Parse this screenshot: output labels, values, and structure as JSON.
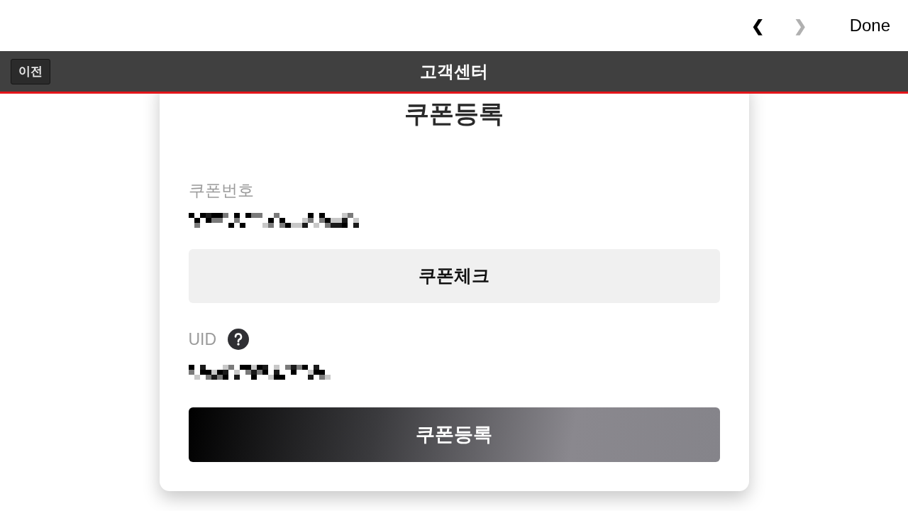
{
  "browser_bar": {
    "nav_buttons": [
      {
        "label": "❮",
        "disabled": false
      },
      {
        "label": "❯",
        "disabled": true
      }
    ],
    "done_button": "Done"
  },
  "header": {
    "back_button": "이전",
    "title": "고객센터"
  },
  "card": {
    "title": "쿠폰등록",
    "coupon_field": {
      "label": "쿠폰번호"
    },
    "check_button": "쿠폰체크",
    "uid_field": {
      "label": "UID",
      "help_icon": true
    },
    "submit_button": "쿠폰등록"
  }
}
